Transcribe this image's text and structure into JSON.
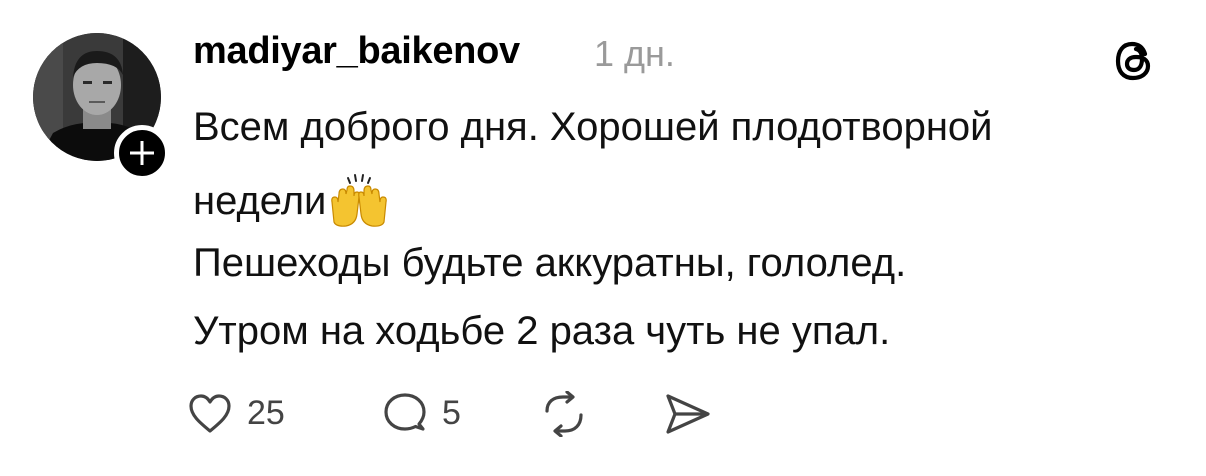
{
  "post": {
    "author": {
      "username": "madiyar_baikenov",
      "avatar_icon": "profile-photo",
      "follow_icon": "plus-icon"
    },
    "timestamp": "1 дн.",
    "platform_icon": "threads-logo-icon",
    "text_lines": [
      "Всем доброго дня. Хорошей плодотворной",
      "недели",
      "Пешеходы будьте аккуратны, гололед.",
      "Утром на ходьбе 2 раза чуть не упал."
    ],
    "emoji": "raising-hands-emoji",
    "actions": {
      "like": {
        "icon": "heart-icon",
        "count": "25"
      },
      "reply": {
        "icon": "comment-bubble-icon",
        "count": "5"
      },
      "repost": {
        "icon": "repost-icon"
      },
      "share": {
        "icon": "send-icon"
      }
    }
  },
  "colors": {
    "text": "#000000",
    "muted": "#9a9a9a",
    "icon": "#444444",
    "background": "#ffffff",
    "emoji": "#f4c430"
  }
}
